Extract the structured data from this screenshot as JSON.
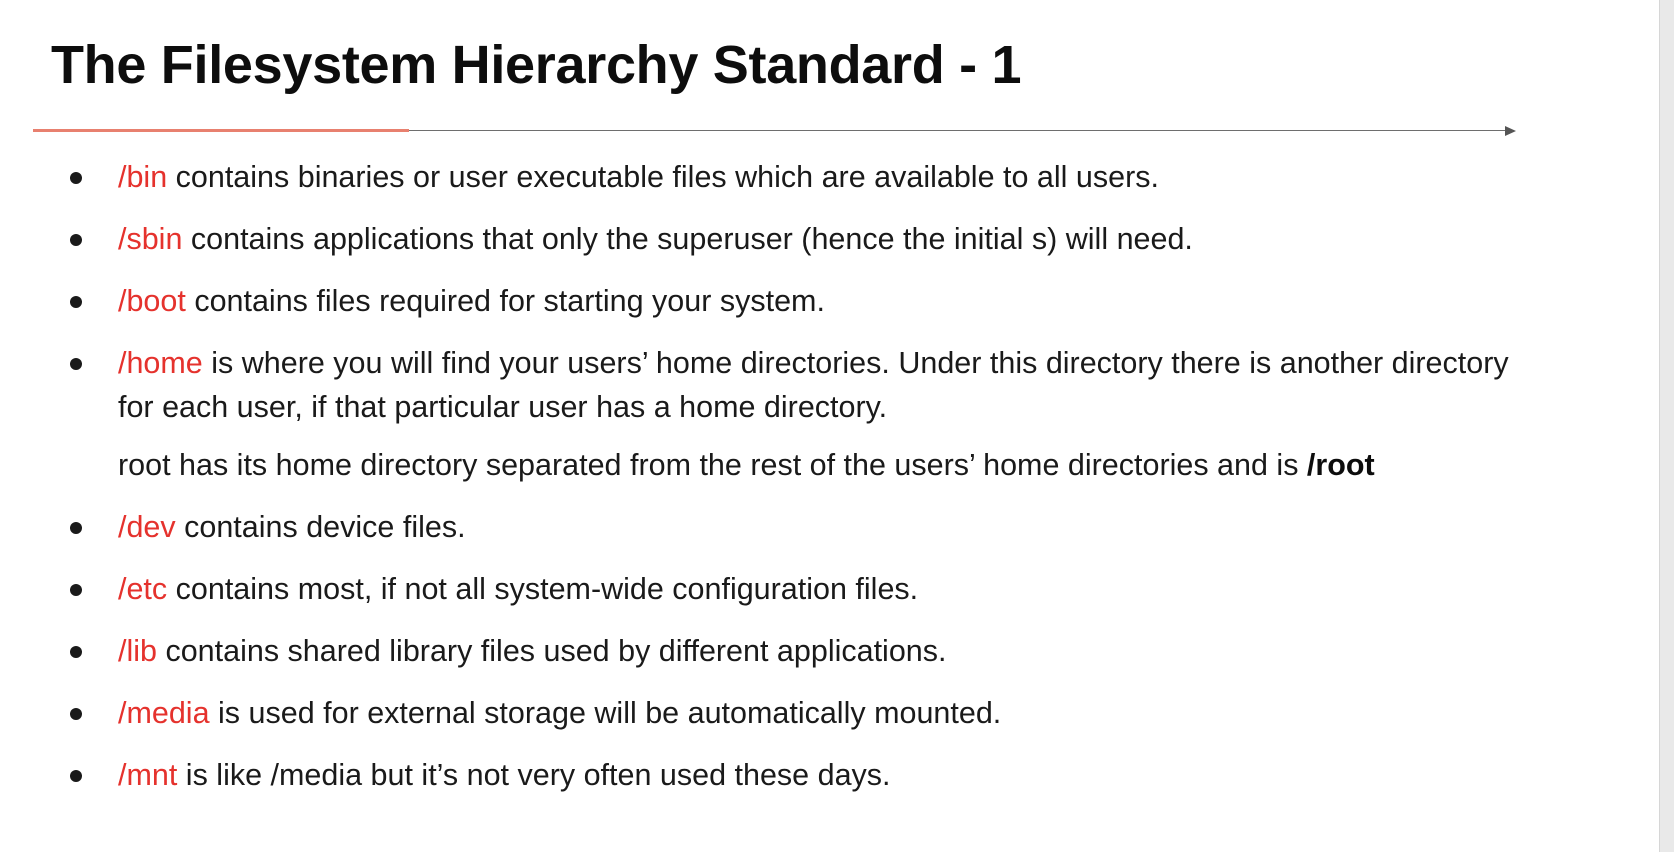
{
  "title": "The Filesystem Hierarchy Standard - 1",
  "items": [
    {
      "dir": "/bin",
      "text": " contains binaries or user executable files which are available to all users."
    },
    {
      "dir": "/sbin",
      "text": " contains applications that only the superuser (hence the initial s) will need."
    },
    {
      "dir": "/boot",
      "text": " contains files required for starting your system."
    },
    {
      "dir": "/home",
      "text": " is where you will find your users’ home directories. Under this directory there is another directory for each user, if that particular user has a home directory."
    },
    {
      "text": "root has its home directory separated from the rest of the users’ home directories and is ",
      "strong": "/root"
    },
    {
      "dir": "/dev",
      "text": " contains device files."
    },
    {
      "dir": "/etc",
      "text": " contains most, if not all system-wide configuration files."
    },
    {
      "dir": "/lib",
      "text": " contains shared library files used by different applications."
    },
    {
      "dir": "/media",
      "text": " is used for external storage will be automatically mounted."
    },
    {
      "dir": "/mnt",
      "text": " is like /media but it’s not very often used these days."
    }
  ]
}
